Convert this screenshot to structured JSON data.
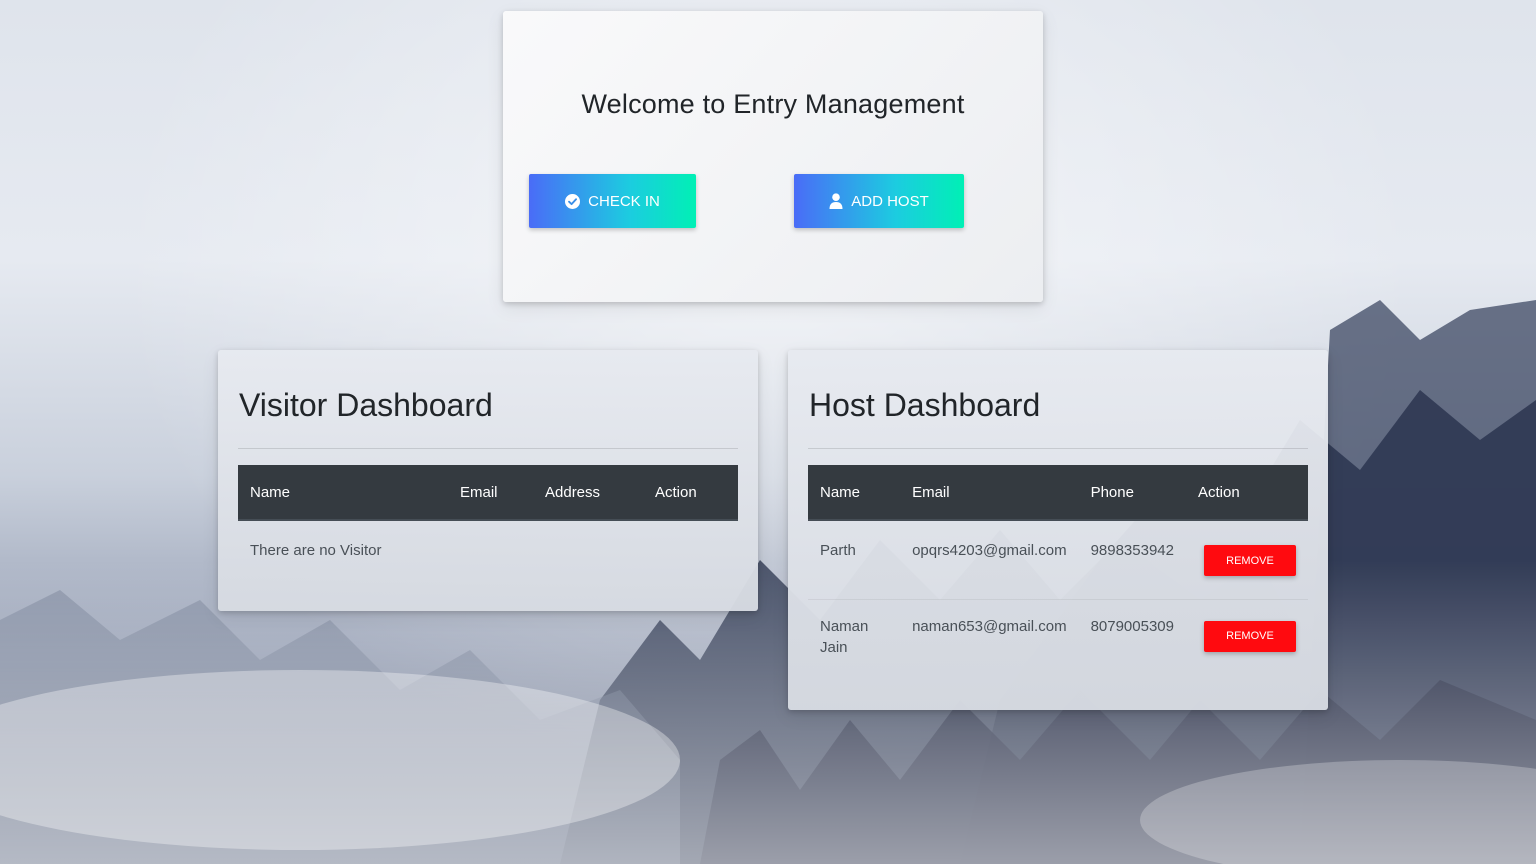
{
  "welcome": {
    "title": "Welcome to Entry Management",
    "check_in_label": "CHECK IN",
    "check_in_icon": "check-circle-icon",
    "add_host_label": "ADD HOST",
    "add_host_icon": "user-icon"
  },
  "visitor_dashboard": {
    "title": "Visitor Dashboard",
    "columns": [
      "Name",
      "Email",
      "Address",
      "Action"
    ],
    "empty_message": "There are no Visitor"
  },
  "host_dashboard": {
    "title": "Host Dashboard",
    "columns": [
      "Name",
      "Email",
      "Phone",
      "Action"
    ],
    "rows": [
      {
        "name": "Parth",
        "email": "opqrs4203@gmail.com",
        "phone": "9898353942",
        "action": "REMOVE"
      },
      {
        "name": "Naman Jain",
        "email": "naman653@gmail.com",
        "phone": "8079005309",
        "action": "REMOVE"
      }
    ]
  },
  "colors": {
    "button_gradient_start": "#4a6cf7",
    "button_gradient_end": "#00f0b5",
    "table_header": "#343a40",
    "remove_button": "#ff0a0f"
  }
}
